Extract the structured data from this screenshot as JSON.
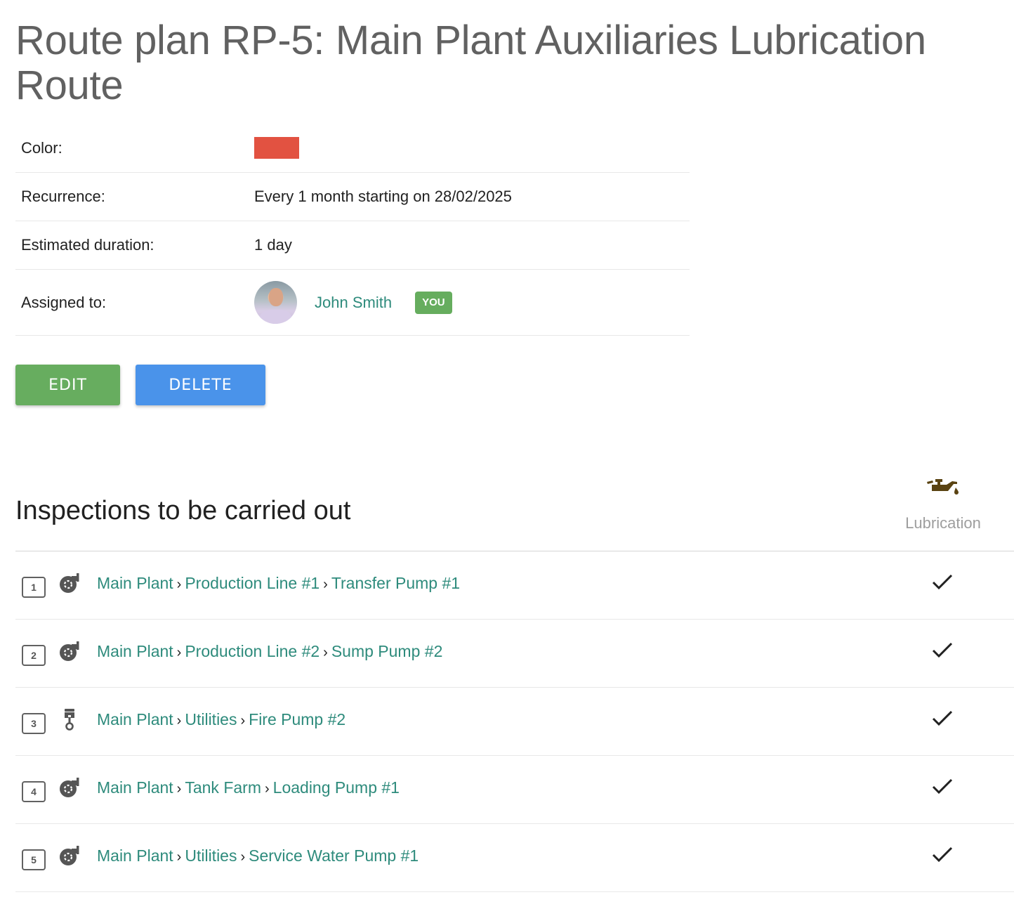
{
  "page": {
    "title": "Route plan RP-5: Main Plant Auxiliaries Lubrication Route"
  },
  "details": {
    "color": {
      "label": "Color:",
      "value": "#e25241"
    },
    "recurrence": {
      "label": "Recurrence:",
      "value": "Every 1 month starting on 28/02/2025"
    },
    "duration": {
      "label": "Estimated duration:",
      "value": "1 day"
    },
    "assigned": {
      "label": "Assigned to:",
      "name": "John Smith",
      "badge": "YOU"
    }
  },
  "actions": {
    "edit_label": "EDIT",
    "delete_label": "DELETE"
  },
  "inspections": {
    "title": "Inspections to be carried out",
    "column_header": {
      "label": "Lubrication",
      "icon": "oil-can-icon"
    },
    "separator": "›",
    "rows": [
      {
        "number": "1",
        "icon": "pump-icon",
        "path": [
          "Main Plant",
          "Production Line #1",
          "Transfer Pump #1"
        ],
        "lubrication": true
      },
      {
        "number": "2",
        "icon": "pump-icon",
        "path": [
          "Main Plant",
          "Production Line #2",
          "Sump Pump #2"
        ],
        "lubrication": true
      },
      {
        "number": "3",
        "icon": "piston-icon",
        "path": [
          "Main Plant",
          "Utilities",
          "Fire Pump #2"
        ],
        "lubrication": true
      },
      {
        "number": "4",
        "icon": "pump-icon",
        "path": [
          "Main Plant",
          "Tank Farm",
          "Loading Pump #1"
        ],
        "lubrication": true
      },
      {
        "number": "5",
        "icon": "pump-icon",
        "path": [
          "Main Plant",
          "Utilities",
          "Service Water Pump #1"
        ],
        "lubrication": true
      }
    ]
  },
  "colors": {
    "link": "#2e8b7c",
    "edit_button": "#67ad5f",
    "delete_button": "#4a93ea",
    "badge": "#66ad5e",
    "oil_icon": "#5a4312"
  }
}
